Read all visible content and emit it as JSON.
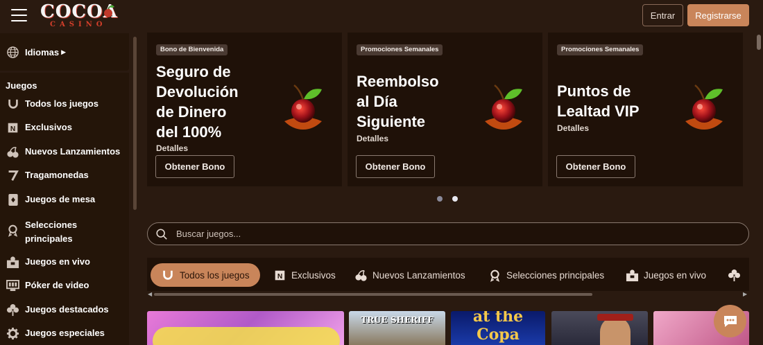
{
  "header": {
    "logo_text": "COCOA",
    "logo_sub": "CASINO",
    "login_label": "Entrar",
    "register_label": "Registrarse"
  },
  "sidebar": {
    "language_label": "Idiomas",
    "section_heading": "Juegos",
    "items": [
      {
        "label": "Todos los juegos",
        "icon": "horseshoe-icon"
      },
      {
        "label": "Exclusivos",
        "icon": "exclusive-badge-icon"
      },
      {
        "label": "Nuevos Lanzamientos",
        "icon": "cherries-icon"
      },
      {
        "label": "Tragamonedas",
        "icon": "seven-icon"
      },
      {
        "label": "Juegos de mesa",
        "icon": "card-icon"
      },
      {
        "label": "Selecciones principales",
        "icon": "award-ribbon-icon"
      },
      {
        "label": "Juegos en vivo",
        "icon": "live-dealer-icon"
      },
      {
        "label": "Póker de video",
        "icon": "video-poker-icon"
      },
      {
        "label": "Juegos destacados",
        "icon": "clover-icon"
      },
      {
        "label": "Juegos especiales",
        "icon": "gear-icon"
      }
    ]
  },
  "promos": [
    {
      "tag": "Bono de Bienvenida",
      "title_lines": [
        "Seguro de",
        "Devolución",
        "de Dinero",
        "del 100%"
      ],
      "details": "Detalles",
      "button": "Obtener Bono"
    },
    {
      "tag": "Promociones Semanales",
      "title_lines": [
        "Reembolso",
        "al Día",
        "Siguiente"
      ],
      "details": "Detalles",
      "button": "Obtener Bono"
    },
    {
      "tag": "Promociones Semanales",
      "title_lines": [
        "Puntos de",
        "Lealtad VIP"
      ],
      "details": "Detalles",
      "button": "Obtener Bono"
    }
  ],
  "carousel": {
    "dots": 2,
    "active_index": 1
  },
  "search": {
    "placeholder": "Buscar juegos..."
  },
  "tabs": [
    {
      "label": "Todos los juegos",
      "icon": "horseshoe-icon",
      "active": true
    },
    {
      "label": "Exclusivos",
      "icon": "exclusive-badge-icon",
      "active": false
    },
    {
      "label": "Nuevos Lanzamientos",
      "icon": "cherries-icon",
      "active": false
    },
    {
      "label": "Selecciones principales",
      "icon": "award-ribbon-icon",
      "active": false
    },
    {
      "label": "Juegos en vivo",
      "icon": "live-dealer-icon",
      "active": false
    },
    {
      "label": "",
      "icon": "clover-icon",
      "active": false
    }
  ],
  "games": [
    {
      "title": ""
    },
    {
      "title": "TRUE SHERIFF"
    },
    {
      "title": "at the Copa"
    },
    {
      "title": ""
    },
    {
      "title": ""
    }
  ],
  "colors": {
    "background": "#2a1a10",
    "panel": "#1f1108",
    "accent": "#c9855a"
  }
}
